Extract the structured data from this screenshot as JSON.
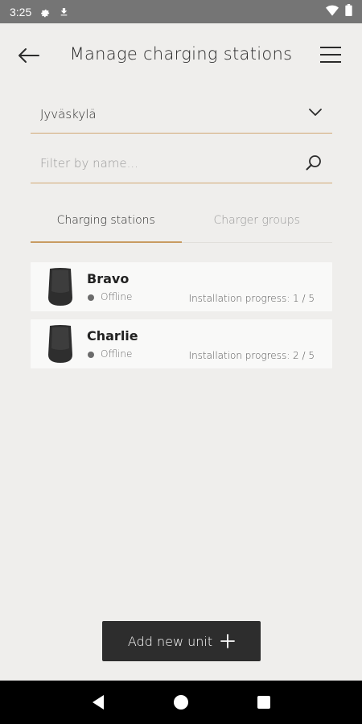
{
  "status_bar": {
    "time": "3:25",
    "icons": [
      "gear-icon",
      "download-icon",
      "wifi-icon",
      "battery-icon"
    ]
  },
  "header": {
    "title": "Manage charging stations",
    "back_icon": "arrow-left-icon",
    "menu_icon": "hamburger-menu-icon"
  },
  "location_select": {
    "value": "Jyväskylä",
    "icon": "chevron-down-icon"
  },
  "search": {
    "placeholder": "Filter by name...",
    "value": "",
    "icon": "search-icon"
  },
  "tabs": [
    {
      "label": "Charging stations",
      "active": true
    },
    {
      "label": "Charger groups",
      "active": false
    }
  ],
  "stations": [
    {
      "name": "Bravo",
      "status": "Offline",
      "progress": "Installation progress: 1 / 5"
    },
    {
      "name": "Charlie",
      "status": "Offline",
      "progress": "Installation progress: 2 / 5"
    }
  ],
  "add_button": {
    "label": "Add new unit",
    "icon": "plus-icon"
  },
  "nav_bar": {
    "icons": [
      "back-triangle-icon",
      "home-circle-icon",
      "recents-square-icon"
    ]
  },
  "colors": {
    "accent": "#c89b61",
    "background": "#efeeec",
    "card": "#f9f9f8",
    "button": "#2d2d2d"
  }
}
